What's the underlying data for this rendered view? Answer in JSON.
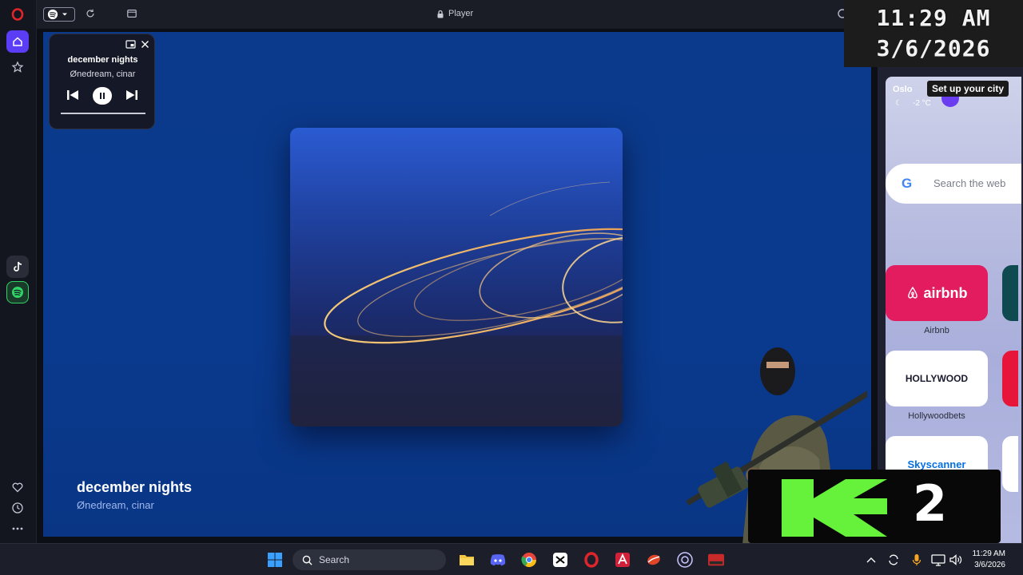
{
  "browser": {
    "page_title": "Player"
  },
  "mini_player": {
    "track_title": "december nights",
    "artist": "Ønedream, cinar",
    "progress": 1.0
  },
  "now_playing": {
    "track_title": "december nights",
    "artist": "Ønedream, cinar"
  },
  "clock_overlay": {
    "time": "11:29 AM",
    "date": "3/6/2026"
  },
  "speed_dial": {
    "weather": {
      "city": "Oslo",
      "temperature": "-2 °C"
    },
    "tooltip": "Set up your city",
    "search": {
      "logo": "G",
      "placeholder": "Search the web"
    },
    "tiles": [
      {
        "name": "airbnb",
        "label": "Airbnb",
        "logo_text": "airbnb",
        "color": "#e31c5f"
      },
      {
        "name": "hollywoodbets",
        "label": "Hollywoodbets",
        "logo_text": "HOLLYWOOD",
        "color": "#ffffff"
      },
      {
        "name": "skyscanner",
        "label": "",
        "logo_text": "Skyscanner",
        "color": "#ffffff"
      }
    ]
  },
  "overlay_logo": {
    "text": "2",
    "accent": "#66f23a"
  },
  "taskbar": {
    "search_label": "Search",
    "time": "11:29 AM",
    "date": "3/6/2026"
  },
  "colors": {
    "player_bg": "#0a3a8e",
    "sidebar_accent": "#5b3df5",
    "spotify_green": "#2fd566"
  }
}
